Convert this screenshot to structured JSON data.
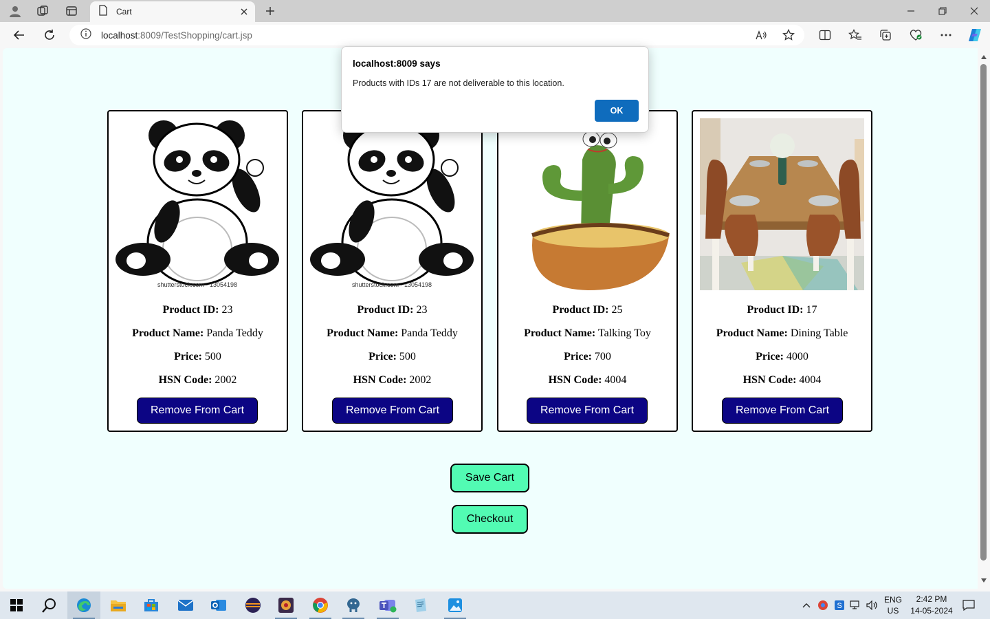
{
  "browser": {
    "tab_title": "Cart",
    "url_host": "localhost",
    "url_rest": ":8009/TestShopping/cart.jsp"
  },
  "products": [
    {
      "id_label": "Product ID:",
      "id": "23",
      "name_label": "Product Name:",
      "name": "Panda Teddy",
      "price_label": "Price:",
      "price": "500",
      "hsn_label": "HSN Code:",
      "hsn": "2002",
      "image": "panda-image",
      "remove_label": "Remove From Cart"
    },
    {
      "id_label": "Product ID:",
      "id": "23",
      "name_label": "Product Name:",
      "name": "Panda Teddy",
      "price_label": "Price:",
      "price": "500",
      "hsn_label": "HSN Code:",
      "hsn": "2002",
      "image": "panda-image",
      "remove_label": "Remove From Cart"
    },
    {
      "id_label": "Product ID:",
      "id": "25",
      "name_label": "Product Name:",
      "name": "Talking Toy",
      "price_label": "Price:",
      "price": "700",
      "hsn_label": "HSN Code:",
      "hsn": "4004",
      "image": "cactus-toy-image",
      "remove_label": "Remove From Cart"
    },
    {
      "id_label": "Product ID:",
      "id": "17",
      "name_label": "Product Name:",
      "name": "Dining Table",
      "price_label": "Price:",
      "price": "4000",
      "hsn_label": "HSN Code:",
      "hsn": "4004",
      "image": "dining-table-image",
      "remove_label": "Remove From Cart"
    }
  ],
  "image_caption": "shutterstock.com · 13054198",
  "actions": {
    "save_cart": "Save Cart",
    "checkout": "Checkout"
  },
  "dialog": {
    "title": "localhost:8009 says",
    "message": "Products with IDs 17 are not deliverable to this location.",
    "ok": "OK"
  },
  "taskbar": {
    "lang": "ENG",
    "region": "US",
    "time": "2:42 PM",
    "date": "14-05-2024"
  },
  "colors": {
    "page_bg": "#f0fffe",
    "remove_button": "#0c0584",
    "green_button": "#52fbb3",
    "dialog_ok": "#0f6cbd"
  }
}
